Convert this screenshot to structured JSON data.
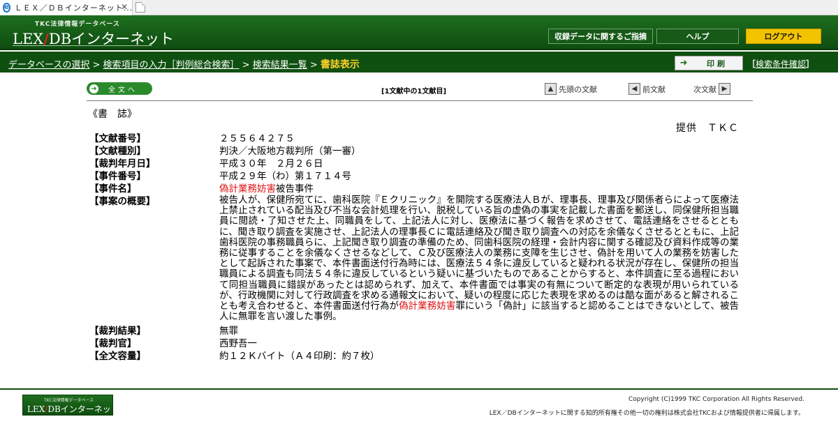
{
  "browser": {
    "tab_title": "ＬＥＸ／ＤＢインターネット...",
    "tab_close": "✕"
  },
  "header": {
    "logo_small": "TKC法律情報データベース",
    "logo_left": "LEX",
    "logo_slash": "/",
    "logo_right": "DBインターネット",
    "guide_button": "収録データに関するご指摘",
    "help_button": "ヘルプ",
    "logout_button": "ログアウト"
  },
  "breadcrumb": {
    "db_select": "データベースの選択",
    "sep": " > ",
    "item_input": "検索項目の入力［判例総合検索］",
    "result_list": "検索結果一覧",
    "current": "書誌表示"
  },
  "toolbar": {
    "print_label": "印刷",
    "print_arrow": "➜",
    "cond_open": "［",
    "cond_link": "検索条件確認",
    "cond_close": "］"
  },
  "docnav": {
    "fulltext_label": "全文へ",
    "fulltext_icon": "➜",
    "position": "[1文献中の1文献目]",
    "first": "先頭の文献",
    "prev": "前文献",
    "next": "次文献",
    "first_icon": "▲",
    "prev_icon": "◀",
    "next_icon": "▶"
  },
  "document": {
    "section": "《書　誌》",
    "provider": "提供　ＴＫＣ",
    "doc_number_label": "【文献番号】",
    "doc_number": "２５５６４２７５",
    "doc_type_label": "【文献種別】",
    "doc_type": "判決／大阪地方裁判所（第一審）",
    "date_label": "【裁判年月日】",
    "date": "平成３０年　２月２６日",
    "case_no_label": "【事件番号】",
    "case_no": "平成２９年（わ）第１７１４号",
    "case_name_label": "【事件名】",
    "case_name_highlight": "偽計業務妨害",
    "case_name_rest": "被告事件",
    "summary_label": "【事案の概要】",
    "summary_part1": "被告人が、保健所宛てに、歯科医院『Ｅクリニック』を開院する医療法人Ｂが、理事長、理事及び関係者らによって医療法上禁止されている配当及び不当な会計処理を行い、脱税している旨の虚偽の事実を記載した書面を郵送し、同保健所担当職員に閲読・了知させた上、同職員をして、上記法人に対し、医療法に基づく報告を求めさせて、電話連絡をさせるとともに、聞き取り調査を実施させ、上記法人の理事長Ｃに電話連絡及び聞き取り調査への対応を余儀なくさせるとともに、上記歯科医院の事務職員らに、上記聞き取り調査の準備のため、同歯科医院の経理・会計内容に関する確認及び資料作成等の業務に従事することを余儀なくさせるなどして、Ｃ及び医療法人の業務に支障を生じさせ、偽計を用いて人の業務を妨害したとして起訴された事案で、本件書面送付行為時には、医療法５４条に違反していると疑われる状況が存在し、保健所の担当職員による調査も同法５４条に違反しているという疑いに基づいたものであることからすると、本件調査に至る過程において同担当職員に錯誤があったとは認められず、加えて、本件書面では事実の有無について断定的な表現が用いられているが、行政機関に対して行政調査を求める通報文において、疑いの程度に応じた表現を求めるのは酷な面があると解されることも考え合わせると、本件書面送付行為が",
    "summary_highlight": "偽計業務妨害",
    "summary_part2": "罪にいう「偽計」に該当すると認めることはできないとして、被告人に無罪を言い渡した事例。",
    "result_label": "【裁判結果】",
    "result": "無罪",
    "judge_label": "【裁判官】",
    "judge": "西野吾一",
    "size_label": "【全文容量】",
    "size": "約１２Ｋバイト（Ａ４印刷：約７枚）"
  },
  "footer": {
    "logo_small": "TKC法律情報データベース",
    "logo_left": "LEX",
    "logo_slash": "/",
    "logo_right": "DBインターネット",
    "copyright": "Copyright (C)1999 TKC Corporation All Rights Reserved.",
    "notice": "LEX／DBインターネットに関する知的所有権その他一切の権利は株式会社TKCおよび情報提供者に帰属します。"
  },
  "colors": {
    "brand_green": "#0f5010",
    "highlight_red": "#e01010",
    "logout_yellow": "#f3c300",
    "current_crumb": "#ffd02a"
  }
}
